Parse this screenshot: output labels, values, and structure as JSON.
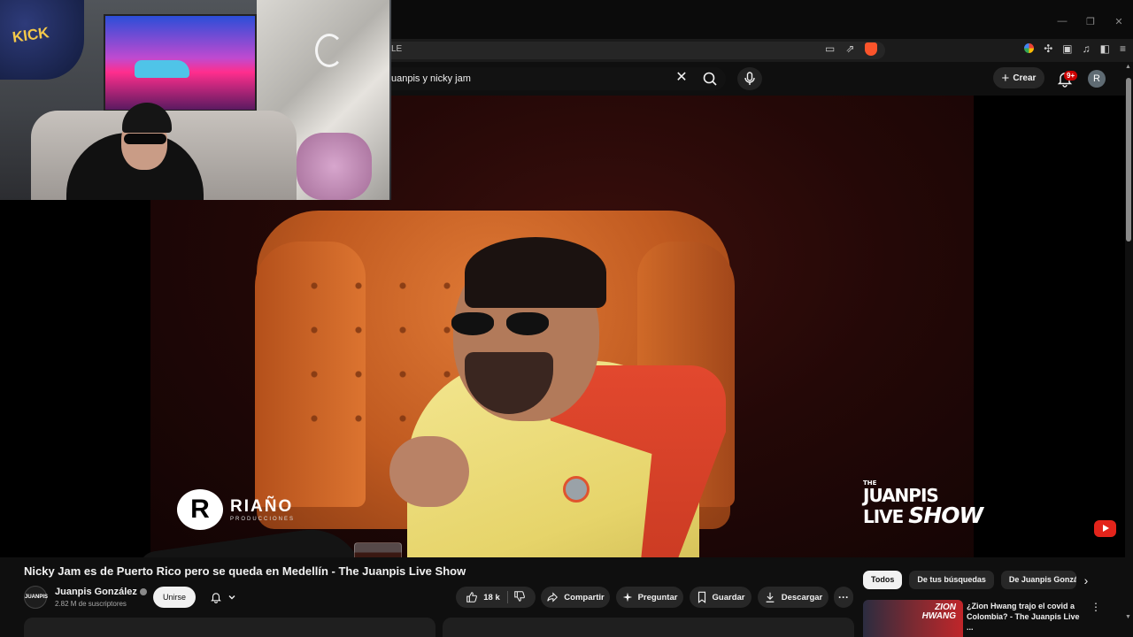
{
  "browser": {
    "url_fragment": "LE",
    "window_controls": [
      "—",
      "❐",
      "✕"
    ]
  },
  "search": {
    "query": "uanpis y nicky jam"
  },
  "header": {
    "create_label": "Crear",
    "notification_badge": "9+",
    "avatar_initial": "R"
  },
  "overlay": {
    "brand_name": "RIAÑO",
    "brand_sub": "PRODUCCIONES",
    "brand_mark": "R",
    "show_the": "THE",
    "show_line1": "JUANPIS",
    "show_line2a": "LIVE",
    "show_line2b": "SHOW"
  },
  "webcam": {
    "sign_text": "KICK"
  },
  "video": {
    "title": "Nicky Jam es de Puerto Rico pero se queda en Medellín - The Juanpis Live Show"
  },
  "channel": {
    "name": "Juanpis González",
    "subscribers": "2.82 M de suscriptores",
    "avatar_text": "JUANPIS",
    "join_label": "Unirse"
  },
  "actions": {
    "likes": "18 k",
    "share": "Compartir",
    "ask": "Preguntar",
    "save": "Guardar",
    "download": "Descargar",
    "more": "···"
  },
  "chips": [
    "Todos",
    "De tus búsquedas",
    "De Juanpis Gonzále"
  ],
  "recommendation": {
    "title": "¿Zion Hwang trajo el covid a Colombia? - The Juanpis Live ...",
    "thumb_text_1": "ZION",
    "thumb_text_2": "HWANG"
  },
  "colors": {
    "background": "#0f0f0f",
    "accent_red": "#e3241b",
    "chip_active": "#f1f1f1"
  }
}
